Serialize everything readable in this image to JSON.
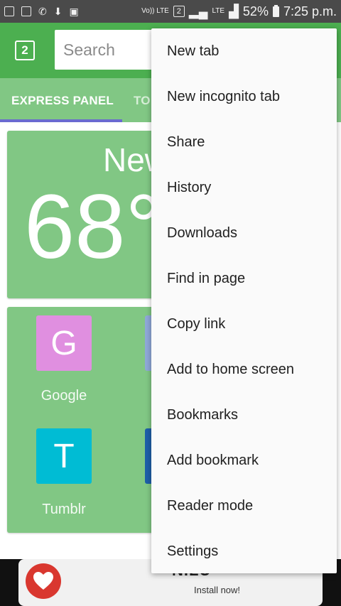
{
  "status_bar": {
    "icons": [
      "n-icon",
      "image-icon",
      "phone-icon",
      "download-icon",
      "clipboard-icon"
    ],
    "volte": "Vo)) LTE",
    "sim": "2",
    "network": "LTE",
    "battery": "52%",
    "time": "7:25 p.m."
  },
  "toolbar": {
    "tab_count": "2",
    "search_placeholder": "Search"
  },
  "tabs": {
    "active": "EXPRESS PANEL",
    "next": "TO"
  },
  "weather": {
    "city": "New",
    "temperature": "68°"
  },
  "speed_dial": [
    {
      "letter": "G",
      "label": "Google",
      "color": "#e08fe0"
    },
    {
      "letter": "T",
      "label": "Tumblr",
      "color": "#00bcd4"
    }
  ],
  "ad": {
    "title": "NILU",
    "cta": "Install now!"
  },
  "menu": {
    "items": [
      "New tab",
      "New incognito tab",
      "Share",
      "History",
      "Downloads",
      "Find in page",
      "Copy link",
      "Add to home screen",
      "Bookmarks",
      "Add bookmark",
      "Reader mode",
      "Settings"
    ]
  },
  "colors": {
    "toolbar": "#4caf50",
    "tabs_bar": "#81c784",
    "underline": "#6a6ad0"
  }
}
